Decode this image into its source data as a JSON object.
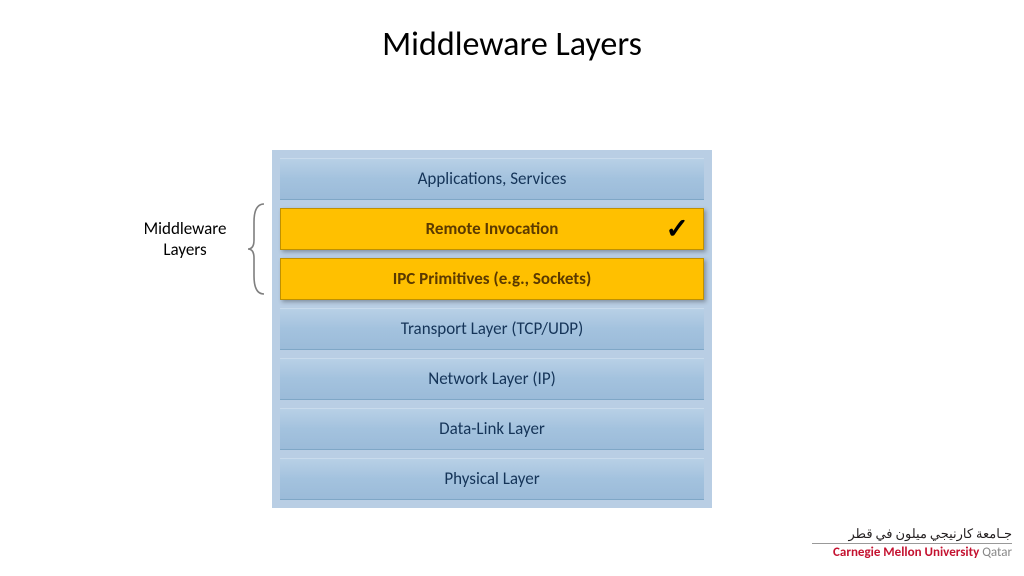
{
  "title": "Middleware Layers",
  "side_label_line1": "Middleware",
  "side_label_line2": "Layers",
  "layers": {
    "l0": "Applications, Services",
    "l1": "Remote Invocation",
    "l2": "IPC Primitives (e.g., Sockets)",
    "l3": "Transport Layer (TCP/UDP)",
    "l4": "Network Layer (IP)",
    "l5": "Data-Link Layer",
    "l6": "Physical Layer"
  },
  "checkmark": "✓",
  "logo": {
    "arabic": "جـامعة كارنيجي ميلون في قطر",
    "en_red": "Carnegie Mellon University",
    "en_grey": " Qatar"
  }
}
